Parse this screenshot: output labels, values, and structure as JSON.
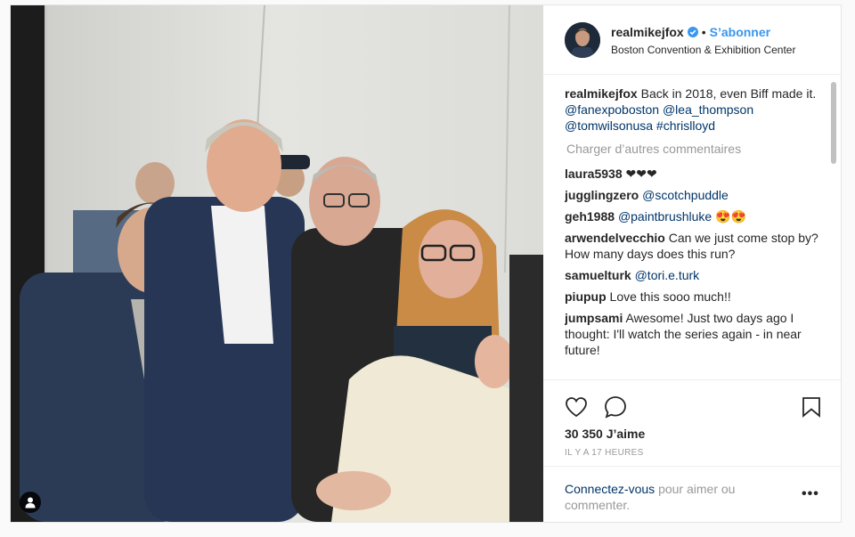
{
  "header": {
    "username": "realmikejfox",
    "separator": "•",
    "follow_label": "S’abonner",
    "location": "Boston Convention & Exhibition Center"
  },
  "caption": {
    "username": "realmikejfox",
    "text": "Back in 2018, even Biff made it.",
    "mentions": [
      "@fanexpoboston",
      "@lea_thompson",
      "@tomwilsonusa",
      "#chrislloyd"
    ]
  },
  "load_more_label": "Charger d’autres commentaires",
  "comments": [
    {
      "user": "laura5938",
      "text": "❤❤❤"
    },
    {
      "user": "jugglingzero",
      "mention": "@scotchpuddle"
    },
    {
      "user": "geh1988",
      "mention": "@paintbrushluke",
      "text": "😍😍"
    },
    {
      "user": "arwendelvecchio",
      "text": "Can we just come stop by? How many days does this run?"
    },
    {
      "user": "samuelturk",
      "mention": "@tori.e.turk"
    },
    {
      "user": "piupup",
      "text": "Love this sooo much!!"
    },
    {
      "user": "jumpsami",
      "text": "Awesome! Just two days ago I thought: I'll watch the series again - in near future!"
    }
  ],
  "likes": "30 350 J’aime",
  "timestamp": "IL Y A 17 HEURES",
  "login": {
    "link_label": "Connectez-vous",
    "text": "pour aimer ou commenter."
  },
  "more_label": "•••",
  "icons": {
    "tag": "person-tag-icon",
    "like": "heart-icon",
    "comment": "comment-bubble-icon",
    "save": "bookmark-icon",
    "verified": "verified-badge-icon",
    "more": "more-options-icon"
  },
  "colors": {
    "accent": "#3897f0",
    "mention": "#003569",
    "muted": "#999999"
  }
}
